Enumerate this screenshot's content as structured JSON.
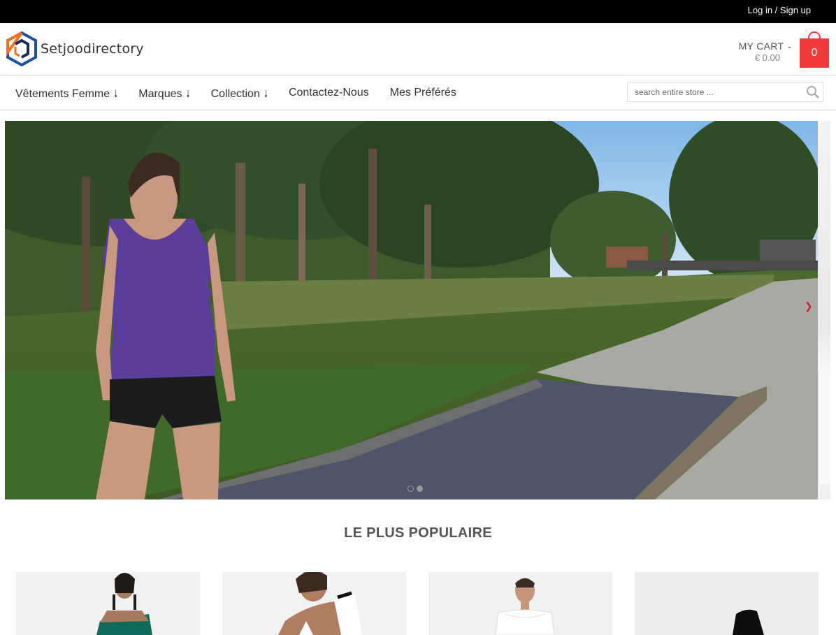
{
  "topbar": {
    "login": "Log in",
    "separator": " / ",
    "signup": "Sign up"
  },
  "header": {
    "logo_text": "Setjoodirectory",
    "logo_colors": [
      "#f36f21",
      "#1e4fa0",
      "#1a2a5e"
    ],
    "cart": {
      "label": "MY CART",
      "total": "€ 0.00",
      "count": "0",
      "color": "#f23c3c"
    }
  },
  "nav": {
    "items": [
      {
        "label": "Vêtements Femme",
        "has_dropdown": true
      },
      {
        "label": "Marques",
        "has_dropdown": true
      },
      {
        "label": "Collection",
        "has_dropdown": true
      },
      {
        "label": "Contactez-Nous",
        "has_dropdown": false
      },
      {
        "label": "Mes Préférés",
        "has_dropdown": false
      }
    ],
    "search": {
      "placeholder": "search entire store ..."
    }
  },
  "hero": {
    "slides": 2,
    "active_slide": 2,
    "image": "woman in purple tank top and black shorts on park boardwalk"
  },
  "popular": {
    "title": "LE PLUS POPULAIRE",
    "products": [
      {
        "image": "woman in green cut-out dress"
      },
      {
        "image": "woman in white and black top"
      },
      {
        "image": "woman in white off-shoulder top"
      },
      {
        "image": "black garment on white background"
      }
    ]
  }
}
